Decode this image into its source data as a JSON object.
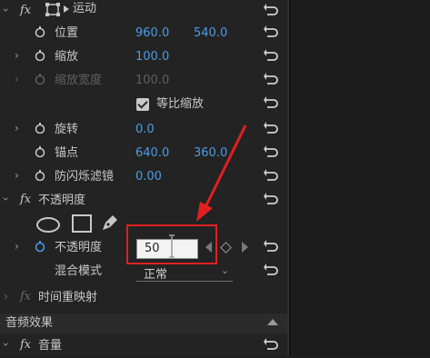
{
  "motion": {
    "title": "运动",
    "position": {
      "label": "位置",
      "x": "960.0",
      "y": "540.0"
    },
    "scale": {
      "label": "缩放",
      "value": "100.0"
    },
    "scale_width": {
      "label": "缩放宽度",
      "value": "100.0"
    },
    "uniform_scale": {
      "label": "等比缩放",
      "checked": true
    },
    "rotation": {
      "label": "旋转",
      "value": "0.0"
    },
    "anchor": {
      "label": "锚点",
      "x": "640.0",
      "y": "360.0"
    },
    "antiflicker": {
      "label": "防闪烁滤镜",
      "value": "0.00"
    }
  },
  "opacity": {
    "title": "不透明度",
    "value_label": "不透明度",
    "input_value": "50",
    "blend_label": "混合模式",
    "blend_value": "正常"
  },
  "time_remap": {
    "title": "时间重映射"
  },
  "audio": {
    "section_title": "音频效果",
    "volume_title": "音量"
  },
  "fx_label": "fx",
  "colors": {
    "accent": "#4a9ce8",
    "annotation": "#e02020"
  }
}
